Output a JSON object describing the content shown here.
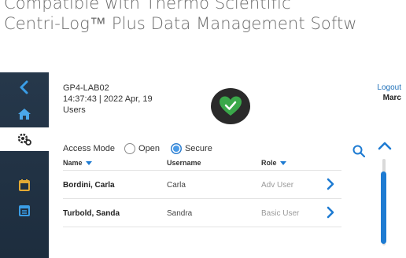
{
  "caption": {
    "line1": "Compatible with Thermo Scientific",
    "line2": "Centri-Log™ Plus Data Management Softw"
  },
  "header": {
    "device_id": "GP4-LAB02",
    "datetime": "14:37:43 | 2022 Apr, 19",
    "section": "Users",
    "logout": "Logout",
    "user": "Marc"
  },
  "access_mode": {
    "label": "Access Mode",
    "options": [
      "Open",
      "Secure"
    ],
    "selected": "Secure"
  },
  "table": {
    "columns": [
      "Name",
      "Username",
      "Role"
    ],
    "rows": [
      {
        "name": "Bordini, Carla",
        "username": "Carla",
        "role": "Adv User"
      },
      {
        "name": "Turbold, Sanda",
        "username": "Sandra",
        "role": "Basic User"
      }
    ]
  },
  "colors": {
    "accent": "#1e7bd2",
    "status_ok": "#3aa84a",
    "sidebar": "#26384b"
  },
  "icons": {
    "sidebar": [
      "back-arrow-icon",
      "home-icon",
      "settings-icon",
      "calendar-icon",
      "calendar-icon"
    ],
    "status": "heart-check-icon"
  }
}
